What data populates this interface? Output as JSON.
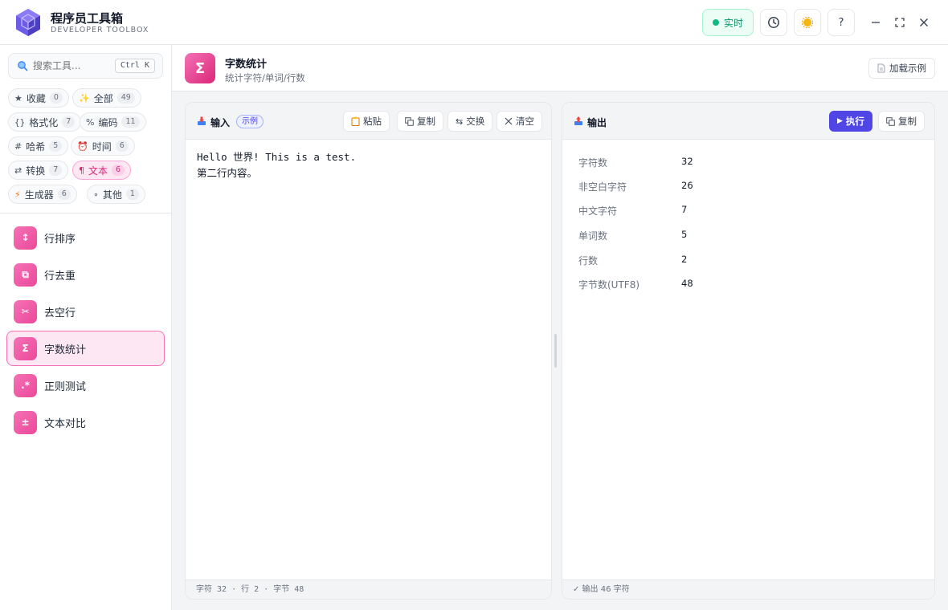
{
  "app": {
    "title": "程序员工具箱",
    "subtitle": "DEVELOPER TOOLBOX",
    "live_label": "实时",
    "help_label": "?"
  },
  "search": {
    "placeholder": "搜索工具...",
    "shortcut": "Ctrl K"
  },
  "categories": [
    {
      "icon": "★",
      "label": "收藏",
      "count": "0"
    },
    {
      "icon": "✨",
      "label": "全部",
      "count": "49"
    },
    {
      "icon": "{}",
      "label": "格式化",
      "count": "7"
    },
    {
      "icon": "%",
      "label": "编码",
      "count": "11"
    },
    {
      "icon": "#",
      "label": "哈希",
      "count": "5"
    },
    {
      "icon": "⏰",
      "label": "时间",
      "count": "6"
    },
    {
      "icon": "⇄",
      "label": "转换",
      "count": "7"
    },
    {
      "icon": "¶",
      "label": "文本",
      "count": "6"
    },
    {
      "icon": "⚡",
      "label": "生成器",
      "count": "6"
    },
    {
      "icon": "∘",
      "label": "其他",
      "count": "1"
    }
  ],
  "tools": [
    {
      "icon": "↕",
      "label": "行排序"
    },
    {
      "icon": "⧉",
      "label": "行去重"
    },
    {
      "icon": "✂",
      "label": "去空行"
    },
    {
      "icon": "Σ",
      "label": "字数统计"
    },
    {
      "icon": ".*",
      "label": "正则测试"
    },
    {
      "icon": "±",
      "label": "文本对比"
    }
  ],
  "header": {
    "icon": "Σ",
    "title": "字数统计",
    "subtitle": "统计字符/单词/行数",
    "load_example": "加载示例"
  },
  "input_panel": {
    "label": "输入",
    "badge": "示例",
    "paste": "粘贴",
    "copy": "复制",
    "swap": "交换",
    "clear": "清空",
    "text": "Hello 世界! This is a test.\n第二行内容。",
    "footer": "字符 32 · 行 2 · 字节 48"
  },
  "output_panel": {
    "label": "输出",
    "run": "执行",
    "copy": "复制",
    "stats": [
      {
        "label": "字符数",
        "value": "32"
      },
      {
        "label": "非空白字符",
        "value": "26"
      },
      {
        "label": "中文字符",
        "value": "7"
      },
      {
        "label": "单词数",
        "value": "5"
      },
      {
        "label": "行数",
        "value": "2"
      },
      {
        "label": "字节数(UTF8)",
        "value": "48"
      }
    ],
    "footer": "✓ 输出 46 字符"
  },
  "colors": {
    "accent": "#4f46e5",
    "pink": "#ec4899",
    "live": "#10b981"
  }
}
